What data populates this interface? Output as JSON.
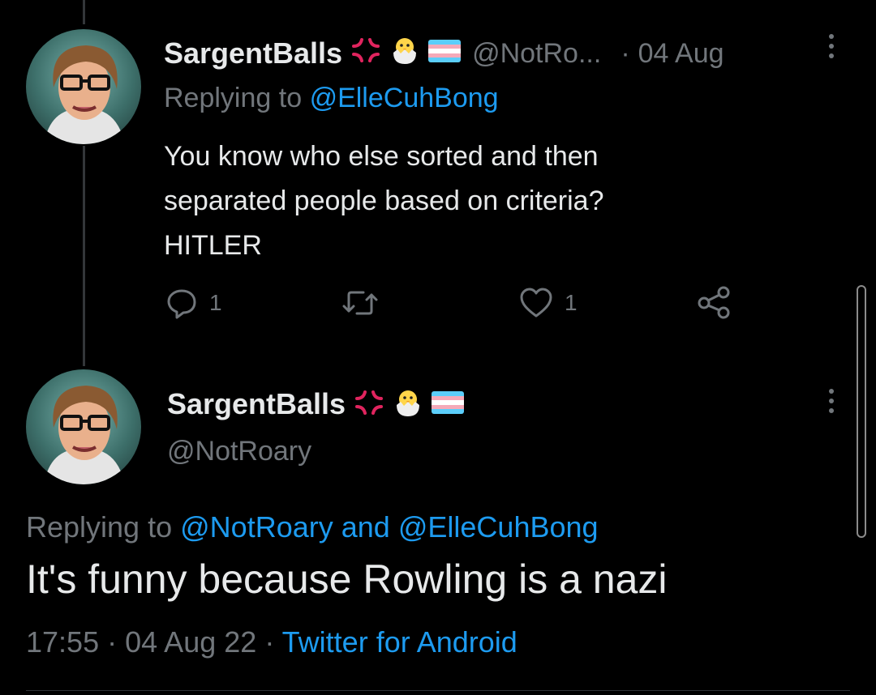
{
  "reply_tweet": {
    "display_name": "SargentBalls",
    "handle": "@NotRo...",
    "separator": "·",
    "date": "04 Aug",
    "replying_to_label": "Replying to",
    "replying_to_handle": "@ElleCuhBong",
    "text_lines": [
      "You know who else sorted and then",
      "separated people based on criteria?",
      "HITLER"
    ],
    "reply_count": "1",
    "like_count": "1",
    "icons": [
      "anger-emoji-icon",
      "hatching-chick-emoji-icon",
      "trans-flag-emoji-icon",
      "more-icon",
      "reply-icon",
      "retweet-icon",
      "like-icon",
      "share-icon"
    ]
  },
  "main_tweet": {
    "display_name": "SargentBalls",
    "handle": "@NotRoary",
    "replying_to_label": "Replying to",
    "replying_to_handle_1": "@NotRoary",
    "replying_to_and": "and",
    "replying_to_handle_2": "@ElleCuhBong",
    "text": "It's funny because Rowling is a nazi",
    "time": "17:55",
    "sep1": "·",
    "date": "04 Aug 22",
    "sep2": "·",
    "source": "Twitter for Android",
    "icons": [
      "anger-emoji-icon",
      "hatching-chick-emoji-icon",
      "trans-flag-emoji-icon",
      "more-icon"
    ]
  },
  "colors": {
    "background": "#000000",
    "text": "#e7e9ea",
    "muted": "#71767b",
    "link": "#1d9bf0",
    "thread_line": "#333639"
  }
}
